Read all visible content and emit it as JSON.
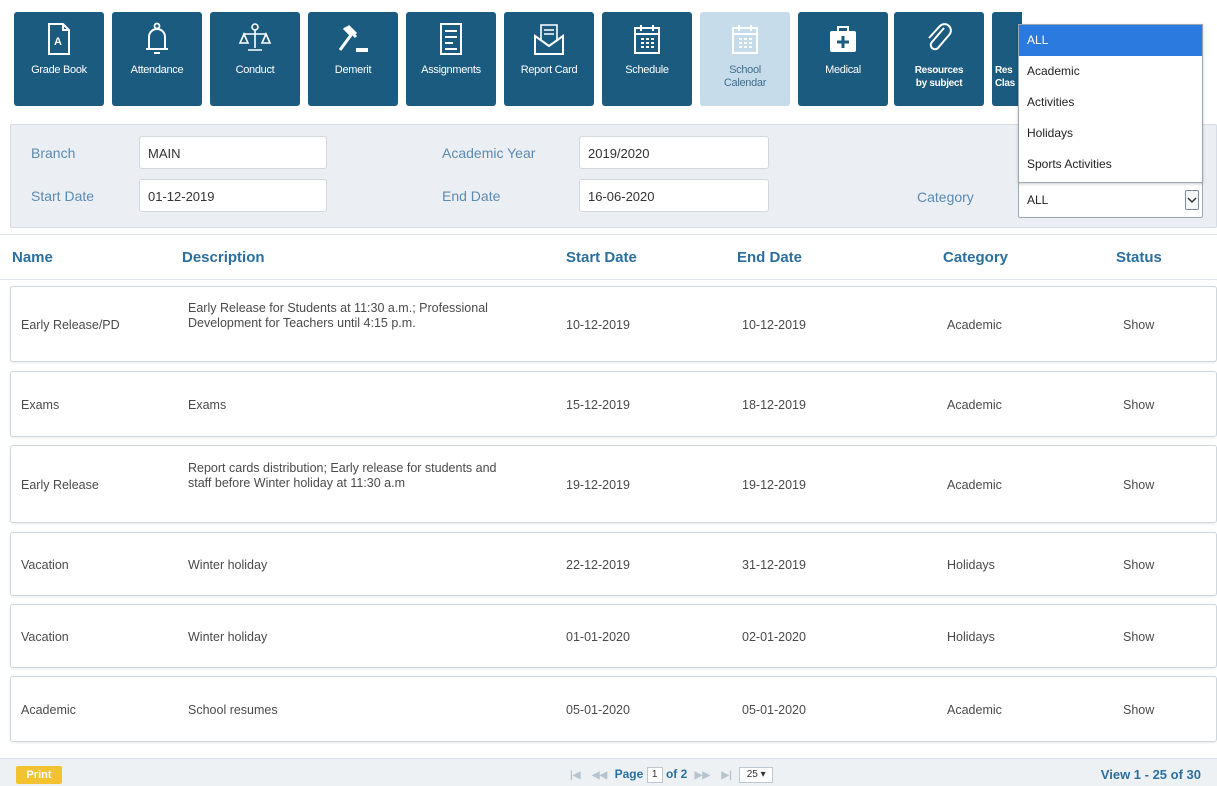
{
  "toolbar": {
    "items": [
      {
        "label": "Grade Book",
        "icon": "grade-book-icon"
      },
      {
        "label": "Attendance",
        "icon": "bell-icon"
      },
      {
        "label": "Conduct",
        "icon": "balance-icon"
      },
      {
        "label": "Demerit",
        "icon": "gavel-icon"
      },
      {
        "label": "Assignments",
        "icon": "assignment-list-icon"
      },
      {
        "label": "Report Card",
        "icon": "envelope-icon"
      },
      {
        "label": "Schedule",
        "icon": "calendar-icon"
      },
      {
        "label": "School Calendar",
        "icon": "school-calendar-icon"
      },
      {
        "label": "Medical",
        "icon": "medical-kit-icon"
      },
      {
        "label": "Resources by subject",
        "icon": "paperclip-icon"
      },
      {
        "label": "Res Clas",
        "icon": "resource-icon"
      }
    ]
  },
  "filters": {
    "branch_label": "Branch",
    "branch_value": "MAIN",
    "academic_year_label": "Academic Year",
    "academic_year_value": "2019/2020",
    "start_date_label": "Start Date",
    "start_date_value": "01-12-2019",
    "end_date_label": "End Date",
    "end_date_value": "16-06-2020",
    "category_label": "Category",
    "category_value": "ALL"
  },
  "category_dropdown": {
    "options": [
      "ALL",
      "Academic",
      "Activities",
      "Holidays",
      "Sports Activities"
    ],
    "selected": "ALL"
  },
  "table": {
    "headers": {
      "name": "Name",
      "description": "Description",
      "start_date": "Start Date",
      "end_date": "End Date",
      "category": "Category",
      "status": "Status"
    },
    "rows": [
      {
        "name": "Early Release/PD",
        "description": "Early Release for Students at 11:30 a.m.; Professional Development for Teachers until 4:15 p.m.",
        "start": "10-12-2019",
        "end": "10-12-2019",
        "category": "Academic",
        "status": "Show"
      },
      {
        "name": "Exams",
        "description": "Exams",
        "start": "15-12-2019",
        "end": "18-12-2019",
        "category": "Academic",
        "status": "Show"
      },
      {
        "name": "Early Release",
        "description": "Report cards distribution; Early release for students and staff before Winter holiday at 11:30 a.m",
        "start": "19-12-2019",
        "end": "19-12-2019",
        "category": "Academic",
        "status": "Show"
      },
      {
        "name": "Vacation",
        "description": "Winter holiday",
        "start": "22-12-2019",
        "end": "31-12-2019",
        "category": "Holidays",
        "status": "Show"
      },
      {
        "name": "Vacation",
        "description": "Winter holiday",
        "start": "01-01-2020",
        "end": "02-01-2020",
        "category": "Holidays",
        "status": "Show"
      },
      {
        "name": "Academic",
        "description": "School resumes",
        "start": "05-01-2020",
        "end": "05-01-2020",
        "category": "Academic",
        "status": "Show"
      }
    ]
  },
  "footer": {
    "print_label": "Print",
    "page_label": "Page",
    "page_value": "1",
    "of_label": "of 2",
    "page_size": "25",
    "view_info": "View 1 - 25 of 30"
  },
  "colors": {
    "tile": "#1b5b80",
    "tile_active": "#c7dcea",
    "header_text": "#2b6f9e",
    "dropdown_selected": "#2a7ae0",
    "print_button": "#f2c230"
  }
}
